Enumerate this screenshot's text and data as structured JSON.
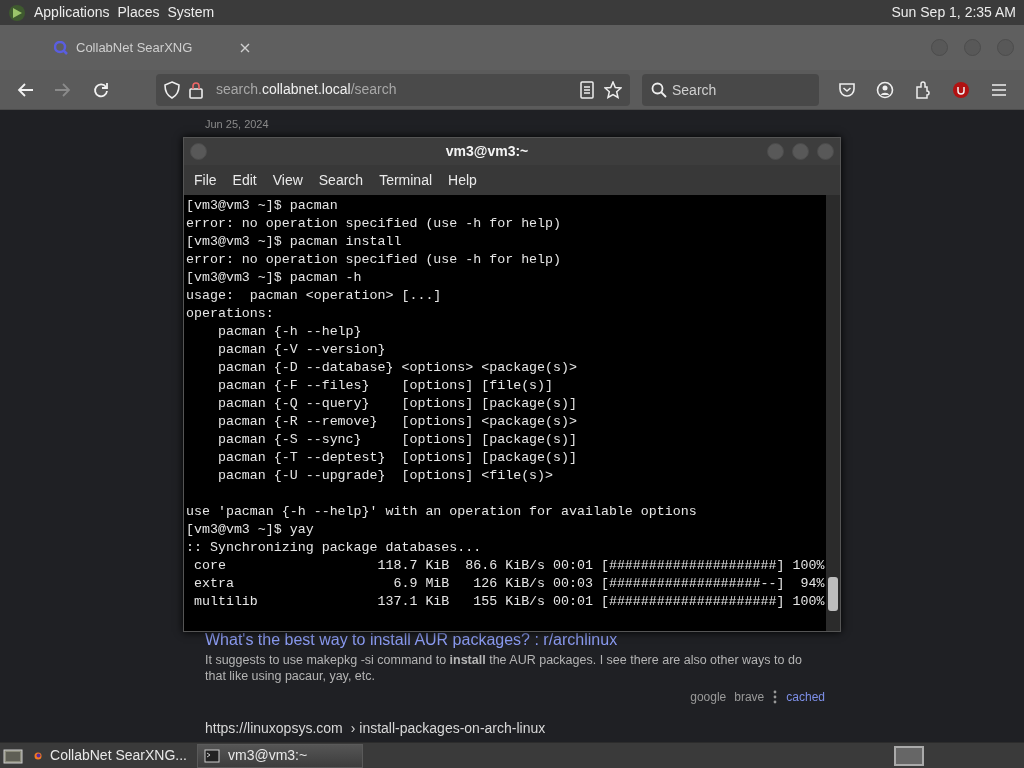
{
  "top_panel": {
    "menus": [
      "Applications",
      "Places",
      "System"
    ],
    "clock": "Sun Sep 1, 2:35 AM"
  },
  "browser": {
    "tab": {
      "title": "CollabNet SearXNG"
    },
    "nav_buttons": [
      {
        "kind": "back",
        "disabled": false
      },
      {
        "kind": "forward",
        "disabled": true
      },
      {
        "kind": "reload",
        "disabled": false
      }
    ],
    "url": {
      "prefix": "search.",
      "domain": "collabnet.local",
      "path": "/search"
    },
    "search": {
      "placeholder": "Search"
    }
  },
  "page": {
    "date": "Jun 25, 2024",
    "result": {
      "title": "What's the best way to install AUR packages? : r/archlinux",
      "snippet": "It suggests to use makepkg -si command to **install** the AUR packages. I see there are also other ways to do that like using pacaur, yay, etc.",
      "engines": [
        "google",
        "brave"
      ],
      "cached": "cached"
    },
    "next_url": {
      "site": "https://linuxopsys.com",
      "path": "› install-packages-on-arch-linux"
    }
  },
  "terminal": {
    "title": "vm3@vm3:~",
    "menus": [
      "File",
      "Edit",
      "View",
      "Search",
      "Terminal",
      "Help"
    ],
    "blocks": [
      {
        "lines": [
          "[vm3@vm3 ~]$ pacman",
          "error: no operation specified (use -h for help)",
          "[vm3@vm3 ~]$ pacman install",
          "error: no operation specified (use -h for help)",
          "[vm3@vm3 ~]$ pacman -h",
          "usage:  pacman <operation> [...]",
          "operations:",
          "    pacman {-h --help}",
          "    pacman {-V --version}",
          "    pacman {-D --database} <options> <package(s)>",
          "    pacman {-F --files}    [options] [file(s)]",
          "    pacman {-Q --query}    [options] [package(s)]",
          "    pacman {-R --remove}   [options] <package(s)>",
          "    pacman {-S --sync}     [options] [package(s)]",
          "    pacman {-T --deptest}  [options] [package(s)]",
          "    pacman {-U --upgrade}  [options] <file(s)>"
        ]
      },
      {
        "lines": [
          "use 'pacman {-h --help}' with an operation for available options",
          "[vm3@vm3 ~]$ yay",
          ":: Synchronizing package databases...",
          " core                   118.7 KiB  86.6 KiB/s 00:01 [#####################] 100%",
          " extra                    6.9 MiB   126 KiB/s 00:03 [###################--]  94%",
          " multilib               137.1 KiB   155 KiB/s 00:01 [#####################] 100%"
        ]
      }
    ]
  },
  "taskbar": {
    "tasks": [
      {
        "kind": "browser",
        "label": "CollabNet SearXNG...",
        "selected": false
      },
      {
        "kind": "terminal",
        "label": "vm3@vm3:~",
        "selected": true
      }
    ]
  }
}
